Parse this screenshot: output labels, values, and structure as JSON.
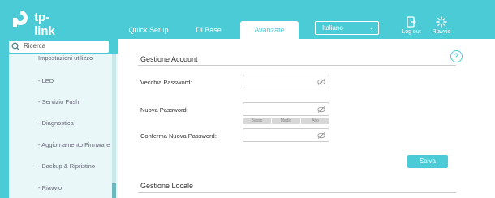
{
  "brand": {
    "name": "tp-link"
  },
  "nav": {
    "tabs": [
      {
        "label": "Quick Setup"
      },
      {
        "label": "Di Base"
      },
      {
        "label": "Avanzate"
      }
    ],
    "language": "Italiano",
    "logout": "Log out",
    "reboot": "Riavvio"
  },
  "sidebar": {
    "search_placeholder": "Ricerca",
    "items": [
      {
        "label": "Impostazioni utilizzo"
      },
      {
        "label": "- LED"
      },
      {
        "label": "- Servizio Push"
      },
      {
        "label": "- Diagnostica"
      },
      {
        "label": "- Aggiornamento Firmware"
      },
      {
        "label": "- Backup & Ripristino"
      },
      {
        "label": "- Riavvio"
      }
    ]
  },
  "account": {
    "title": "Gestione Account",
    "old_password_label": "Vecchia Password:",
    "new_password_label": "Nuova Password:",
    "confirm_password_label": "Conferma Nuova Password:",
    "strength": [
      "Basso",
      "Medio",
      "Alto"
    ],
    "save": "Salva"
  },
  "local": {
    "title": "Gestione Locale"
  },
  "colors": {
    "accent": "#4acbd6",
    "sidebar_bg": "#e9f7f8"
  }
}
